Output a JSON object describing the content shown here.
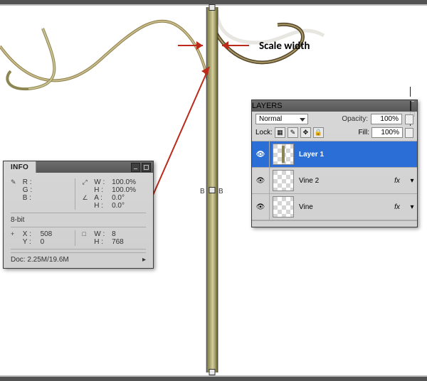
{
  "annotation": {
    "scale_width": "Scale width"
  },
  "side_mark_left": "B",
  "side_mark_right": "B",
  "info_panel": {
    "title": "INFO",
    "rgb": {
      "R": "R :",
      "G": "G :",
      "B": "B :"
    },
    "wh_pct": {
      "W": "W :",
      "H": "H :",
      "Wv": "100.0%",
      "Hv": "100.0%"
    },
    "angle": {
      "A": "A :",
      "H": "H :",
      "Av": "0.0°",
      "Hv": "0.0°"
    },
    "bit": "8-bit",
    "xy": {
      "X": "X :",
      "Y": "Y :",
      "Xv": "508",
      "Yv": "0"
    },
    "wh": {
      "W": "W :",
      "H": "H :",
      "Wv": "8",
      "Hv": "768"
    },
    "doc_label": "Doc:",
    "doc_value": "2.25M/19.6M"
  },
  "layers_panel": {
    "title": "LAYERS",
    "blend": "Normal",
    "opacity_label": "Opacity:",
    "opacity_value": "100%",
    "lock_label": "Lock:",
    "fill_label": "Fill:",
    "fill_value": "100%",
    "layers": [
      {
        "name": "Layer 1",
        "sel": true,
        "fx": "",
        "filled": true
      },
      {
        "name": "Vine 2",
        "sel": false,
        "fx": "fx",
        "filled": false
      },
      {
        "name": "Vine",
        "sel": false,
        "fx": "fx",
        "filled": false
      }
    ]
  }
}
